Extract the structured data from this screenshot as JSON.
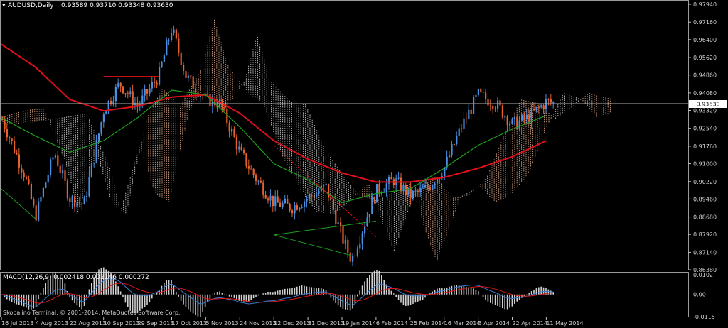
{
  "window": {
    "symbol_line": "AUDUSD,Daily",
    "ohlc_line": "0.93589 0.93710 0.93348 0.93630",
    "current_price_label": "0.93630",
    "copyright": "Skopalino Terminal, © 2001-2014, MetaQuotes Software Corp."
  },
  "colors": {
    "bull": "#4a8fe0",
    "bear": "#e8622a",
    "sma_slow": "#e0101a",
    "sma_fast": "#1ea01e",
    "ichimoku_bull": "#e8b090",
    "ichimoku_bear": "#d8d8d8",
    "macd_line": "#3a7fd5",
    "signal_line": "#e01818",
    "hist": "#e8e8e8"
  },
  "chart_data": [
    {
      "type": "candlestick",
      "title": "AUDUSD,Daily",
      "ylim": [
        0.8638,
        0.9794
      ],
      "y_ticks": [
        "0.97940",
        "0.97160",
        "0.96400",
        "0.95620",
        "0.94860",
        "0.94080",
        "0.93630",
        "0.93320",
        "0.92540",
        "0.91760",
        "0.91000",
        "0.90220",
        "0.89460",
        "0.88680",
        "0.87920",
        "0.87140",
        "0.86380"
      ],
      "x_ticks": [
        "16 Jul 2013",
        "4 Aug 2013",
        "22 Aug 2013",
        "10 Sep 2013",
        "29 Sep 2013",
        "17 Oct 2013",
        "5 Nov 2013",
        "24 Nov 2013",
        "12 Dec 2013",
        "31 Dec 2013",
        "19 Jan 2014",
        "6 Feb 2014",
        "25 Feb 2014",
        "16 Mar 2014",
        "3 Apr 2014",
        "22 Apr 2014",
        "11 May 2014"
      ],
      "key_closes": [
        {
          "date": "16 Jul 2013",
          "close": 0.93
        },
        {
          "date": "29 Jul 2013",
          "close": 0.905
        },
        {
          "date": "4 Aug 2013",
          "close": 0.887
        },
        {
          "date": "14 Aug 2013",
          "close": 0.915
        },
        {
          "date": "22 Aug 2013",
          "close": 0.895
        },
        {
          "date": "30 Aug 2013",
          "close": 0.892
        },
        {
          "date": "10 Sep 2013",
          "close": 0.933
        },
        {
          "date": "19 Sep 2013",
          "close": 0.945
        },
        {
          "date": "29 Sep 2013",
          "close": 0.935
        },
        {
          "date": "10 Oct 2013",
          "close": 0.948
        },
        {
          "date": "17 Oct 2013",
          "close": 0.969
        },
        {
          "date": "25 Oct 2013",
          "close": 0.948
        },
        {
          "date": "5 Nov 2013",
          "close": 0.938
        },
        {
          "date": "13 Nov 2013",
          "close": 0.936
        },
        {
          "date": "24 Nov 2013",
          "close": 0.915
        },
        {
          "date": "3 Dec 2013",
          "close": 0.903
        },
        {
          "date": "12 Dec 2013",
          "close": 0.893
        },
        {
          "date": "22 Dec 2013",
          "close": 0.891
        },
        {
          "date": "31 Dec 2013",
          "close": 0.895
        },
        {
          "date": "10 Jan 2014",
          "close": 0.9
        },
        {
          "date": "19 Jan 2014",
          "close": 0.878
        },
        {
          "date": "24 Jan 2014",
          "close": 0.868
        },
        {
          "date": "6 Feb 2014",
          "close": 0.898
        },
        {
          "date": "16 Feb 2014",
          "close": 0.903
        },
        {
          "date": "25 Feb 2014",
          "close": 0.896
        },
        {
          "date": "6 Mar 2014",
          "close": 0.899
        },
        {
          "date": "16 Mar 2014",
          "close": 0.908
        },
        {
          "date": "25 Mar 2014",
          "close": 0.926
        },
        {
          "date": "3 Apr 2014",
          "close": 0.94
        },
        {
          "date": "13 Apr 2014",
          "close": 0.936
        },
        {
          "date": "22 Apr 2014",
          "close": 0.927
        },
        {
          "date": "1 May 2014",
          "close": 0.93
        },
        {
          "date": "11 May 2014",
          "close": 0.937
        },
        {
          "date": "15 May 2014",
          "close": 0.9363
        }
      ],
      "sma_slow": [
        {
          "date": "16 Jul 2013",
          "value": 0.962
        },
        {
          "date": "4 Aug 2013",
          "value": 0.952
        },
        {
          "date": "22 Aug 2013",
          "value": 0.938
        },
        {
          "date": "10 Sep 2013",
          "value": 0.933
        },
        {
          "date": "29 Sep 2013",
          "value": 0.935
        },
        {
          "date": "17 Oct 2013",
          "value": 0.939
        },
        {
          "date": "5 Nov 2013",
          "value": 0.94
        },
        {
          "date": "24 Nov 2013",
          "value": 0.932
        },
        {
          "date": "12 Dec 2013",
          "value": 0.92
        },
        {
          "date": "31 Dec 2013",
          "value": 0.912
        },
        {
          "date": "19 Jan 2014",
          "value": 0.906
        },
        {
          "date": "6 Feb 2014",
          "value": 0.902
        },
        {
          "date": "25 Feb 2014",
          "value": 0.902
        },
        {
          "date": "16 Mar 2014",
          "value": 0.904
        },
        {
          "date": "3 Apr 2014",
          "value": 0.908
        },
        {
          "date": "22 Apr 2014",
          "value": 0.913
        },
        {
          "date": "11 May 2014",
          "value": 0.92
        }
      ],
      "sma_fast": [
        {
          "date": "16 Jul 2013",
          "value": 0.93
        },
        {
          "date": "4 Aug 2013",
          "value": 0.922
        },
        {
          "date": "22 Aug 2013",
          "value": 0.915
        },
        {
          "date": "10 Sep 2013",
          "value": 0.92
        },
        {
          "date": "29 Sep 2013",
          "value": 0.93
        },
        {
          "date": "17 Oct 2013",
          "value": 0.942
        },
        {
          "date": "5 Nov 2013",
          "value": 0.94
        },
        {
          "date": "24 Nov 2013",
          "value": 0.926
        },
        {
          "date": "12 Dec 2013",
          "value": 0.91
        },
        {
          "date": "31 Dec 2013",
          "value": 0.903
        },
        {
          "date": "19 Jan 2014",
          "value": 0.893
        },
        {
          "date": "6 Feb 2014",
          "value": 0.897
        },
        {
          "date": "25 Feb 2014",
          "value": 0.899
        },
        {
          "date": "16 Mar 2014",
          "value": 0.908
        },
        {
          "date": "3 Apr 2014",
          "value": 0.918
        },
        {
          "date": "22 Apr 2014",
          "value": 0.925
        },
        {
          "date": "11 May 2014",
          "value": 0.931
        }
      ]
    },
    {
      "type": "bar",
      "title": "MACD(12,26,9) 0.002418 0.002146 0.000272",
      "ylim": [
        -0.0115,
        0.0102
      ],
      "y_ticks": [
        "0.0102",
        "0.00",
        "-0.0115"
      ]
    }
  ]
}
